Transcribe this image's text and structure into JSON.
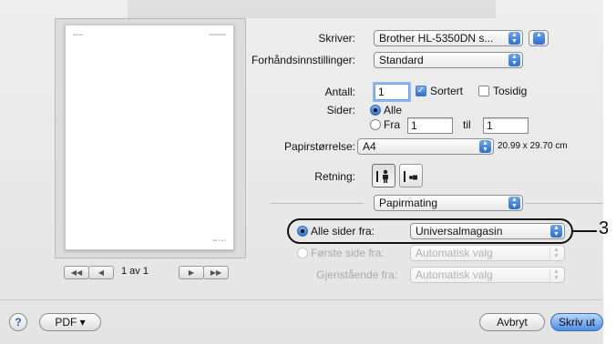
{
  "preview": {
    "page_header_left": "Heit sett",
    "page_header_right": "00000000000",
    "page_footer": "Side 1 av 1",
    "page_indicator": "1 av 1",
    "nav": {
      "first": "◀◀",
      "prev": "◀",
      "next": "▶",
      "last": "▶▶"
    }
  },
  "printer": {
    "label": "Skriver:",
    "value": "Brother HL-5350DN s..."
  },
  "presets": {
    "label": "Forhåndsinnstillinger:",
    "value": "Standard"
  },
  "copies": {
    "label": "Antall:",
    "value": "1",
    "collated_label": "Sortert",
    "collated": true,
    "twosided_label": "Tosidig",
    "twosided": false
  },
  "pages": {
    "label": "Sider:",
    "all_label": "Alle",
    "from_label": "Fra",
    "from_value": "1",
    "to_label": "til",
    "to_value": "1",
    "selected": "all"
  },
  "paper_size": {
    "label": "Papirstørrelse:",
    "value": "A4",
    "dimensions": "20.99 x 29.70 cm"
  },
  "orientation": {
    "label": "Retning:",
    "selected": "portrait"
  },
  "panel_select": {
    "value": "Papirmating"
  },
  "paper_feed": {
    "all_pages_label": "Alle sider fra:",
    "all_pages_value": "Universalmagasin",
    "first_page_label": "Første side fra:",
    "first_page_value": "Automatisk valg",
    "remaining_label": "Gjenstående fra:",
    "remaining_value": "Automatisk valg"
  },
  "callout_number": "3",
  "bottom": {
    "help": "?",
    "pdf": "PDF ▾",
    "cancel": "Avbryt",
    "print": "Skriv ut"
  },
  "colors": {
    "accent": "#2c6fd0",
    "dialog_bg": "#e8e8e8"
  }
}
